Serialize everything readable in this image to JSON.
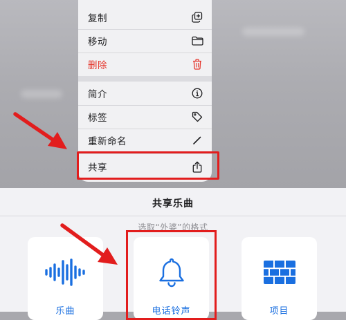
{
  "context_menu": {
    "items": [
      {
        "label": "复制",
        "icon": "duplicate-icon"
      },
      {
        "label": "移动",
        "icon": "folder-icon"
      },
      {
        "label": "删除",
        "icon": "trash-icon",
        "destructive": true
      },
      {
        "label": "简介",
        "icon": "info-icon"
      },
      {
        "label": "标签",
        "icon": "tag-icon"
      },
      {
        "label": "重新命名",
        "icon": "pencil-icon"
      },
      {
        "label": "共享",
        "icon": "share-icon",
        "highlighted": true
      }
    ]
  },
  "share_sheet": {
    "title": "共享乐曲",
    "subtitle": "选取“外婆”的格式",
    "options": [
      {
        "label": "乐曲",
        "icon": "waveform-icon"
      },
      {
        "label": "电话铃声",
        "icon": "bell-icon",
        "highlighted": true
      },
      {
        "label": "项目",
        "icon": "bricks-icon"
      }
    ]
  },
  "colors": {
    "accent": "#1a6fe0",
    "destructive": "#e5342a",
    "annotation": "#e21d1d"
  }
}
